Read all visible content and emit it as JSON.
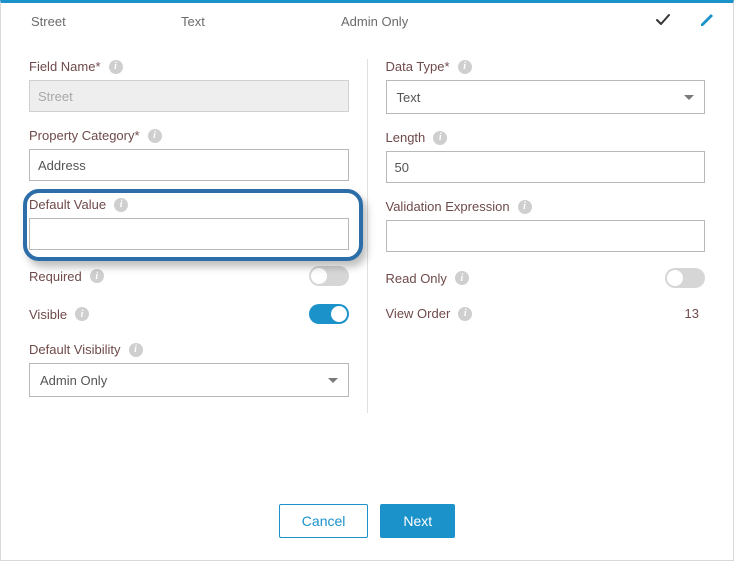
{
  "header": {
    "col1": "Street",
    "col2": "Text",
    "col3": "Admin Only"
  },
  "left": {
    "fieldName": {
      "label": "Field Name*",
      "value": "Street"
    },
    "propertyCategory": {
      "label": "Property Category*",
      "value": "Address"
    },
    "defaultValue": {
      "label": "Default Value",
      "value": ""
    },
    "required": {
      "label": "Required",
      "on": false
    },
    "visible": {
      "label": "Visible",
      "on": true
    },
    "defaultVisibility": {
      "label": "Default Visibility",
      "value": "Admin Only"
    }
  },
  "right": {
    "dataType": {
      "label": "Data Type*",
      "value": "Text"
    },
    "length": {
      "label": "Length",
      "value": "50"
    },
    "validation": {
      "label": "Validation Expression",
      "value": ""
    },
    "readOnly": {
      "label": "Read Only",
      "on": false
    },
    "viewOrder": {
      "label": "View Order",
      "value": "13"
    }
  },
  "buttons": {
    "cancel": "Cancel",
    "next": "Next"
  }
}
